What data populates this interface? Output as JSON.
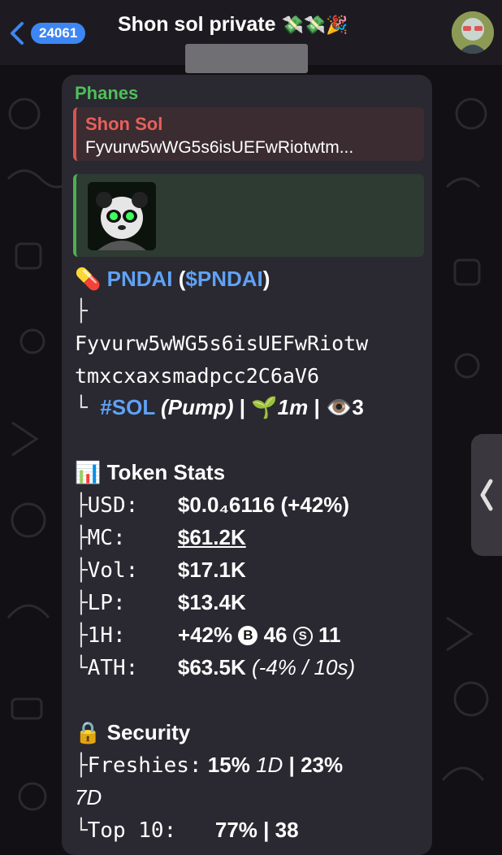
{
  "header": {
    "back_count": "24061",
    "title": "Shon sol private",
    "title_emojis": "💸💸🎉"
  },
  "message": {
    "sender": "Phanes",
    "reply": {
      "name": "Shon Sol",
      "text": "Fyvurw5wWG5s6isUEFwRiotwtm..."
    },
    "token": {
      "emoji": "💊",
      "name": "PNDAI",
      "ticker": "$PNDAI",
      "address_line1": "Fyvurw5wWG5s6isUEFwRiotw",
      "address_line2": "tmxcxaxsmadpcc2C6aV6",
      "chain": "#SOL",
      "platform": "(Pump)",
      "age_emoji": "🌱",
      "age": "1m",
      "views_emoji": "👁️",
      "views": "3"
    },
    "stats": {
      "heading_emoji": "📊",
      "heading": "Token Stats",
      "usd_label": "USD:",
      "usd_value": "$0.0₄6116 (+42%)",
      "mc_label": "MC:",
      "mc_value": "$61.2K",
      "vol_label": "Vol:",
      "vol_value": "$17.1K",
      "lp_label": "LP:",
      "lp_value": "$13.4K",
      "h1_label": "1H:",
      "h1_change": "+42%",
      "h1_buy_icon": "B",
      "h1_buys": "46",
      "h1_sell_icon": "S",
      "h1_sells": "11",
      "ath_label": "ATH:",
      "ath_value": "$63.5K",
      "ath_detail": "(-4% / 10s)"
    },
    "security": {
      "heading_emoji": "🔒",
      "heading": "Security",
      "freshies_label": "Freshies:",
      "freshies_1d": "15%",
      "freshies_1d_unit": "1D",
      "freshies_7d": "23%",
      "freshies_7d_unit": "7D",
      "top10_label": "Top 10:",
      "top10_value": "77% | 38"
    }
  },
  "colors": {
    "sender": "#4fbf5a",
    "reply_accent": "#e8605a",
    "link": "#5fa2f5",
    "badge": "#3d86f3"
  }
}
